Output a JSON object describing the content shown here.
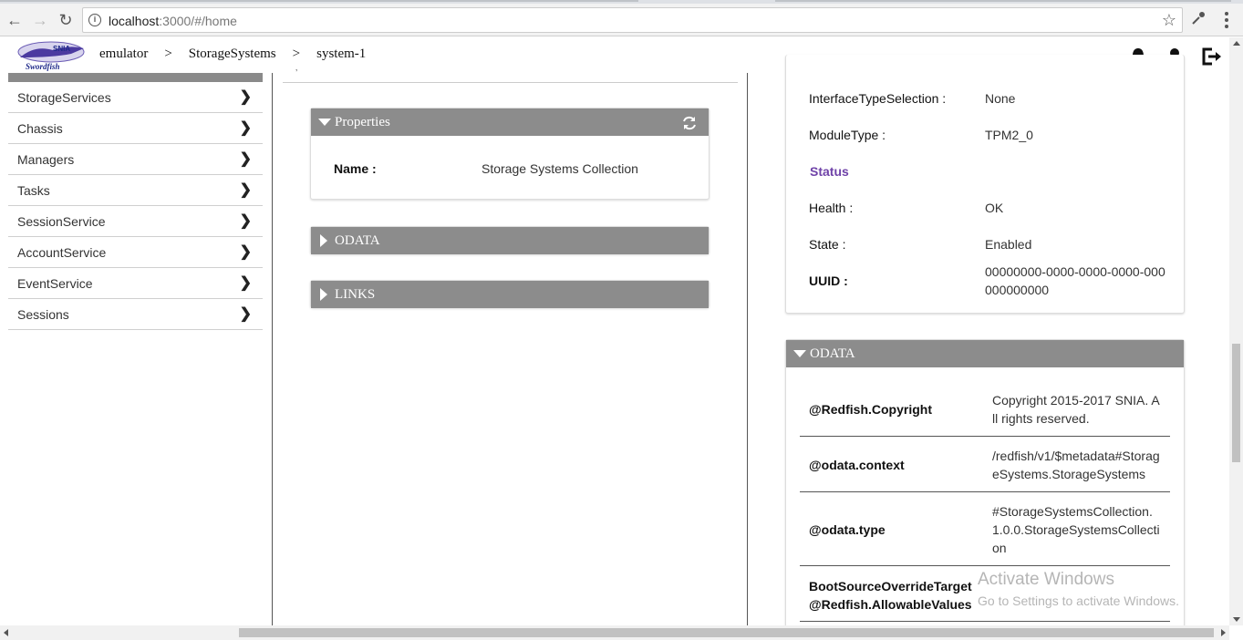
{
  "browser": {
    "url_host": "localhost",
    "url_rest": ":3000/#/home"
  },
  "header": {
    "logo_text": "SNIA Swordfish",
    "breadcrumb": [
      "emulator",
      "StorageSystems",
      "system-1"
    ],
    "separator": ">"
  },
  "sidebar": {
    "items": [
      {
        "label": "StorageServices"
      },
      {
        "label": "Chassis"
      },
      {
        "label": "Managers"
      },
      {
        "label": "Tasks"
      },
      {
        "label": "SessionService"
      },
      {
        "label": "AccountService"
      },
      {
        "label": "EventService"
      },
      {
        "label": "Sessions"
      }
    ]
  },
  "middle": {
    "properties_title": "Properties",
    "name_label": "Name :",
    "name_value": "Storage Systems Collection",
    "odata_title": "ODATA",
    "links_title": "LINKS"
  },
  "right": {
    "rows": [
      {
        "label": "InterfaceTypeSelection :",
        "value": "None"
      },
      {
        "label": "ModuleType :",
        "value": "TPM2_0"
      }
    ],
    "status_title": "Status",
    "status_rows": [
      {
        "label": "Health :",
        "value": "OK"
      },
      {
        "label": "State :",
        "value": "Enabled"
      }
    ],
    "uuid_label": "UUID :",
    "uuid_value_1": "00000000-0000-0000-0000-000",
    "uuid_value_2": "000000000",
    "odata_title": "ODATA",
    "odata_rows": [
      {
        "key": "@Redfish.Copyright",
        "val1": "Copyright 2015-2017 SNIA. A",
        "val2": "ll rights reserved.",
        "val3": ""
      },
      {
        "key": "@odata.context",
        "val1": "/redfish/v1/$metadata#Storag",
        "val2": "eSystems.StorageSystems",
        "val3": ""
      },
      {
        "key": "@odata.type",
        "val1": "#StorageSystemsCollection.",
        "val2": "1.0.0.StorageSystemsCollecti",
        "val3": "on"
      }
    ],
    "last_key_1": "BootSourceOverrideTarget",
    "last_key_2": "@Redfish.AllowableValues"
  },
  "watermark": {
    "line1": "Activate Windows",
    "line2": "Go to Settings to activate Windows."
  },
  "colors": {
    "panel_header": "#8c8c8c",
    "status_purple": "#6f42a8"
  }
}
